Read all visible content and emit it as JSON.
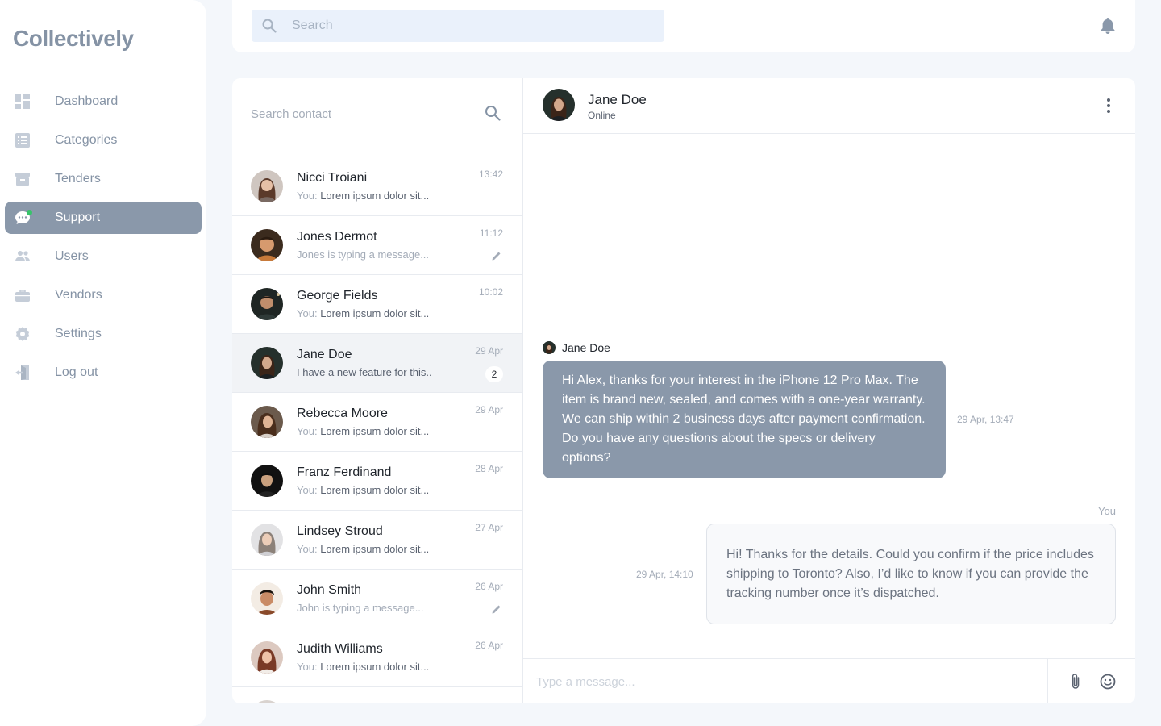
{
  "app": {
    "logo": "Collectively"
  },
  "sidebar": {
    "items": [
      {
        "label": "Dashboard",
        "icon": "dashboard-icon",
        "active": false
      },
      {
        "label": "Categories",
        "icon": "list-icon",
        "active": false
      },
      {
        "label": "Tenders",
        "icon": "archive-icon",
        "active": false
      },
      {
        "label": "Support",
        "icon": "chat-bubble-icon",
        "active": true
      },
      {
        "label": "Users",
        "icon": "users-icon",
        "active": false
      },
      {
        "label": "Vendors",
        "icon": "briefcase-icon",
        "active": false
      },
      {
        "label": "Settings",
        "icon": "gear-icon",
        "active": false
      },
      {
        "label": "Log out",
        "icon": "logout-icon",
        "active": false
      }
    ]
  },
  "topbar": {
    "search_placeholder": "Search"
  },
  "contacts": {
    "search_placeholder": "Search contact",
    "list": [
      {
        "name": "Nicci Troiani",
        "you": "You:",
        "preview": "Lorem ipsum dolor sit...",
        "time": "13:42",
        "typing": false
      },
      {
        "name": "Jones Dermot",
        "you": "",
        "preview": "Jones is typing a message...",
        "time": "11:12",
        "typing": true
      },
      {
        "name": "George Fields",
        "you": "You:",
        "preview": "Lorem ipsum dolor sit...",
        "time": "10:02",
        "typing": false
      },
      {
        "name": "Jane Doe",
        "you": "",
        "preview": "I have a new feature for this..",
        "time": "29 Apr",
        "typing": false,
        "badge": "2",
        "active": true
      },
      {
        "name": "Rebecca Moore",
        "you": "You:",
        "preview": "Lorem ipsum dolor sit...",
        "time": "29 Apr",
        "typing": false
      },
      {
        "name": "Franz Ferdinand",
        "you": "You:",
        "preview": "Lorem ipsum dolor sit...",
        "time": "28 Apr",
        "typing": false
      },
      {
        "name": "Lindsey Stroud",
        "you": "You:",
        "preview": "Lorem ipsum dolor sit...",
        "time": "27 Apr",
        "typing": false
      },
      {
        "name": "John Smith",
        "you": "",
        "preview": "John is typing a message...",
        "time": "26 Apr",
        "typing": true
      },
      {
        "name": "Judith Williams",
        "you": "You:",
        "preview": "Lorem ipsum dolor sit...",
        "time": "26 Apr",
        "typing": false
      }
    ]
  },
  "chat": {
    "name": "Jane Doe",
    "status": "Online",
    "incoming": {
      "sender": "Jane Doe",
      "text": "Hi Alex, thanks for your interest in the iPhone 12 Pro Max. The item is brand new, sealed, and comes with a one-year warranty. We can ship within 2 business days after payment confirmation. Do you have any questions about the specs or delivery options?",
      "time": "29 Apr, 13:47"
    },
    "outgoing": {
      "label": "You",
      "text": "Hi! Thanks for the details. Could you confirm if the price includes shipping to Toronto? Also, I’d like to know if you can provide the tracking number once it’s dispatched.",
      "time": "29 Apr, 14:10"
    },
    "composer_placeholder": "Type a message..."
  },
  "colors": {
    "accent": "#8a98aa",
    "online": "#37c46a",
    "muted": "#8593a5"
  }
}
